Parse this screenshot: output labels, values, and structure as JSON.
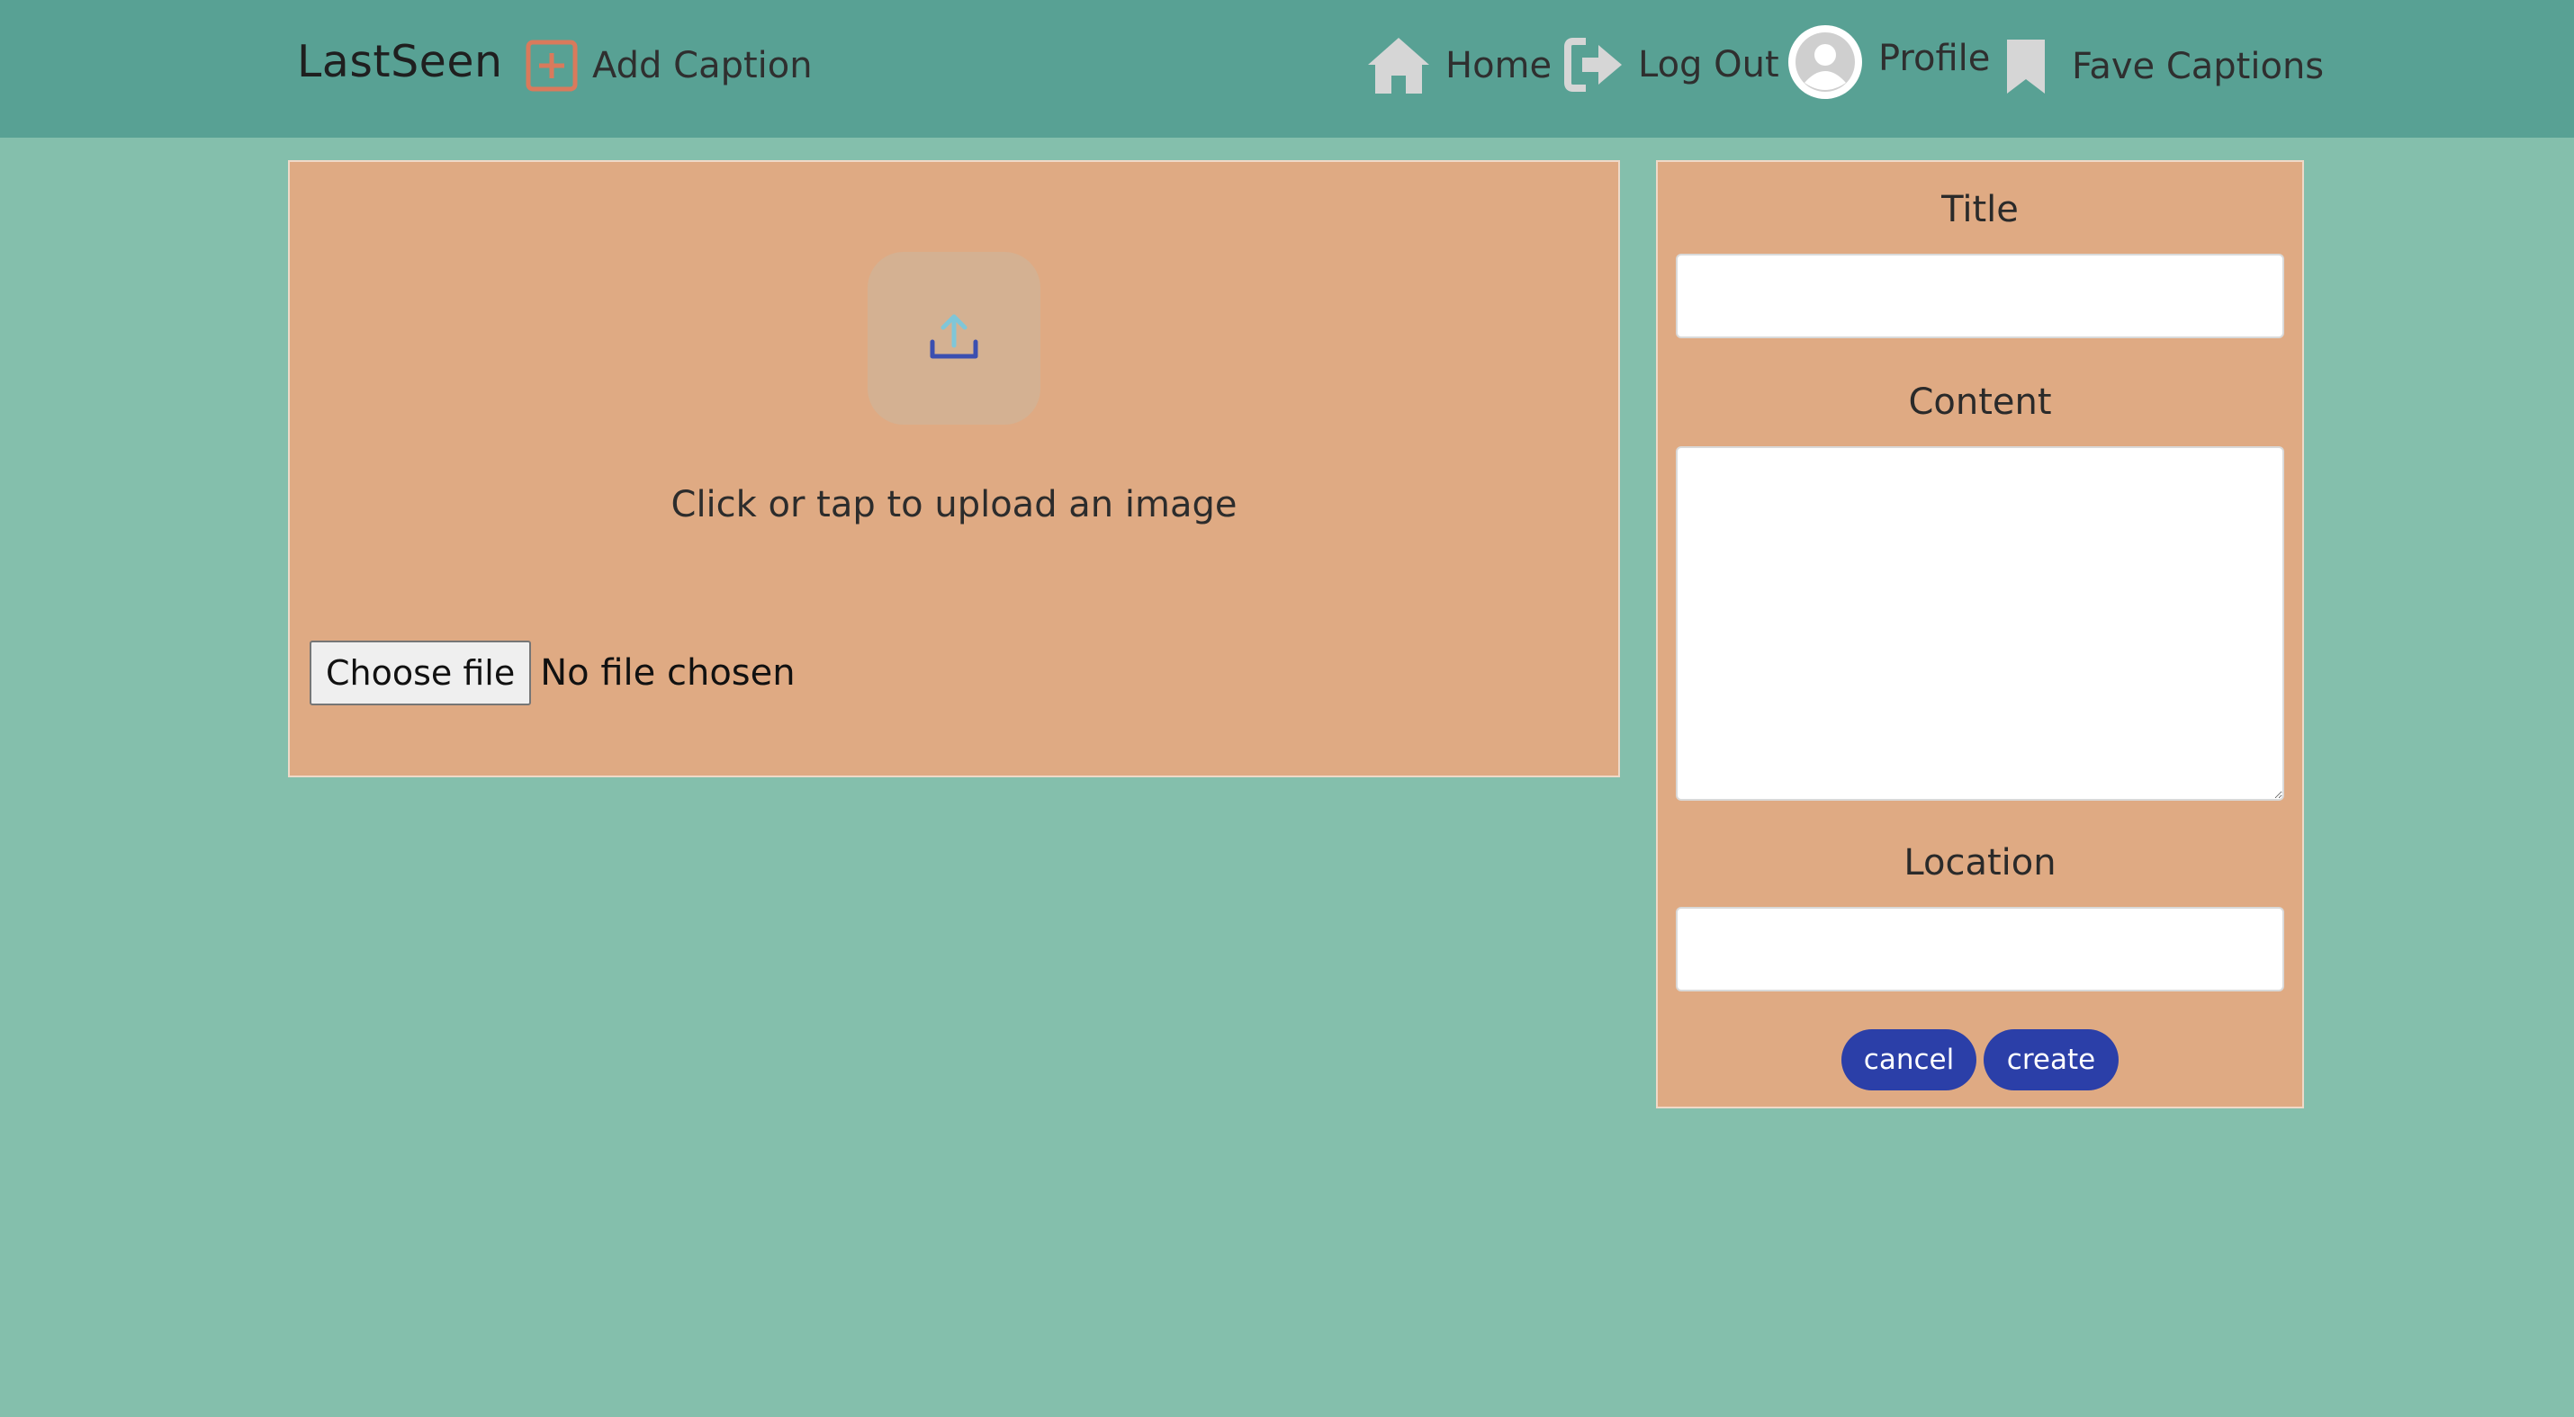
{
  "navbar": {
    "brand": "LastSeen",
    "add_caption": {
      "label": "Add Caption",
      "icon": "plus-square-icon",
      "icon_color": "#d97a5c"
    },
    "home": {
      "label": "Home",
      "icon": "home-icon"
    },
    "logout": {
      "label": "Log Out",
      "icon": "logout-icon"
    },
    "profile": {
      "label": "Profile",
      "icon": "avatar-icon"
    },
    "fave": {
      "label": "Fave Captions",
      "icon": "bookmark-icon"
    }
  },
  "upload": {
    "icon": "upload-icon",
    "prompt": "Click or tap to upload an image",
    "choose_file_label": "Choose file",
    "file_status": "No file chosen"
  },
  "form": {
    "title_label": "Title",
    "title_value": "",
    "content_label": "Content",
    "content_value": "",
    "location_label": "Location",
    "location_value": "",
    "cancel_label": "cancel",
    "create_label": "create"
  },
  "colors": {
    "background": "#84bfac",
    "navbar": "#58a194",
    "panel": "#dfaa83",
    "button": "#2b3fa8",
    "nav_icon": "#d6d6d6"
  }
}
